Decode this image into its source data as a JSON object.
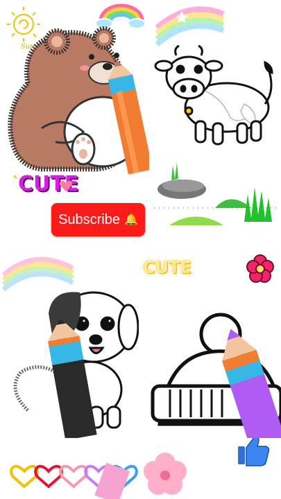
{
  "labels": {
    "sun_text": "Sun.",
    "cute_top": "CUTE",
    "cute_bottom": "CUTE",
    "subscribe": "Subscribe"
  },
  "icons": {
    "bell": "bell-icon",
    "like": "thumbs-up-icon"
  },
  "colors": {
    "subscribe_bg": "#ff1a1a",
    "cute_top": "#d61fe0",
    "cute_bottom": "#f2c200",
    "bear": "#b87a63",
    "pencil_orange": "#f07d32",
    "pencil_blue": "#37b7e6",
    "pencil_purple": "#b05cf2",
    "pencil_black": "#2a2a2a"
  }
}
